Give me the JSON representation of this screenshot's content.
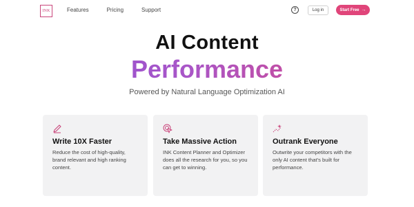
{
  "header": {
    "logo_text": "INK",
    "nav": [
      "Features",
      "Pricing",
      "Support"
    ],
    "help_label": "?",
    "login_label": "Log in",
    "cta_label": "Start Free",
    "cta_arrow": "→"
  },
  "hero": {
    "title": "AI Content",
    "highlight": "Performance",
    "tagline": "Powered by Natural Language Optimization AI"
  },
  "cards": [
    {
      "icon": "pen-icon",
      "title": "Write 10X Faster",
      "text": "Reduce the cost of high-quality, brand relevant and high ranking content."
    },
    {
      "icon": "target-cursor-icon",
      "title": "Take Massive Action",
      "text": "INK Content Planner and Optimizer does all the research for you, so you can get to winning."
    },
    {
      "icon": "sparkle-chart-icon",
      "title": "Outrank Everyone",
      "text": "Outwrite your competitors with the only AI content that’s built for performance."
    }
  ],
  "colors": {
    "accent": "#e0457a",
    "gradient_start": "#8a4fd6",
    "gradient_end": "#e0457a"
  }
}
